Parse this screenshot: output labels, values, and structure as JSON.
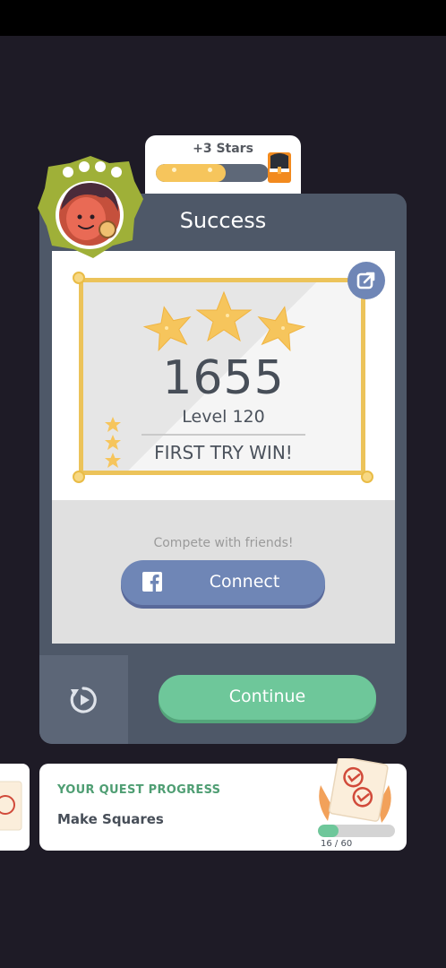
{
  "stars_reward": {
    "label": "+3 Stars",
    "progress": 0.62
  },
  "card": {
    "title": "Success",
    "score": "1655",
    "level": "Level 120",
    "badge_text": "FIRST TRY WIN!",
    "stars_earned": 3,
    "compete_text": "Compete with friends!",
    "connect_label": "Connect",
    "continue_label": "Continue"
  },
  "quest": {
    "header": "YOUR QUEST PROGRESS",
    "name": "Make Squares",
    "progress_text": "16 / 60",
    "progress": 0.2667
  },
  "colors": {
    "card_bg": "#4e5868",
    "star": "#f6c55c",
    "facebook": "#6f86b6",
    "continue": "#6ec79a"
  },
  "icons": [
    "share-icon",
    "facebook-icon",
    "replay-icon",
    "chest-icon",
    "avatar-icon",
    "quest-stamp-icon"
  ]
}
